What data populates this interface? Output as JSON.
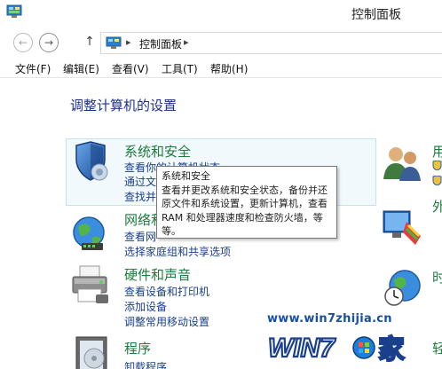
{
  "window": {
    "title": "控制面板"
  },
  "nav": {
    "back_glyph": "←",
    "forward_glyph": "→",
    "up_glyph": "↑",
    "address_separator": "▸",
    "address_text": "控制面板",
    "address_chevron": "▸"
  },
  "menu": {
    "items": [
      {
        "label": "文件(F)"
      },
      {
        "label": "编辑(E)"
      },
      {
        "label": "查看(V)"
      },
      {
        "label": "工具(T)"
      },
      {
        "label": "帮助(H)"
      }
    ]
  },
  "content": {
    "heading": "调整计算机的设置",
    "categories": [
      {
        "title": "系统和安全",
        "links": [
          "查看你的计算机状态",
          "通过文",
          "查找并"
        ]
      },
      {
        "title": "网络和",
        "links": [
          "查看网",
          "选择家庭组和共享选项"
        ]
      },
      {
        "title": "硬件和声音",
        "links": [
          "查看设备和打印机",
          "添加设备",
          "调整常用移动设置"
        ]
      },
      {
        "title": "程序",
        "links": [
          "卸载程序"
        ]
      }
    ],
    "right_column": [
      {
        "title": "用",
        "links": [
          "",
          ""
        ]
      },
      {
        "title": "外",
        "links": [
          "",
          ""
        ]
      },
      {
        "title": "时",
        "links": [
          "",
          ""
        ]
      },
      {
        "title": "轻",
        "links": []
      }
    ]
  },
  "tooltip": {
    "title": "系统和安全",
    "body": "查看并更改系统和安全状态，备份并还原文件和系统设置，更新计算机，查看 RAM 和处理器速度和检查防火墙，等等。"
  },
  "watermark": {
    "url": "www.win7zhijia.cn",
    "brand": "WIN7之家"
  },
  "colors": {
    "heading": "#1e3287",
    "category_title": "#1e7a3d",
    "link": "#1a3f8c",
    "hover_box": "#f2f9fd",
    "hover_border": "#c5e2f1"
  },
  "icons": {
    "app": "control-panel-icon",
    "security": "shield-icon",
    "network": "network-globe-icon",
    "hardware": "printer-icon",
    "programs": "programs-disc-icon",
    "users": "users-icon",
    "appearance": "appearance-icon",
    "clock": "clock-globe-icon"
  }
}
